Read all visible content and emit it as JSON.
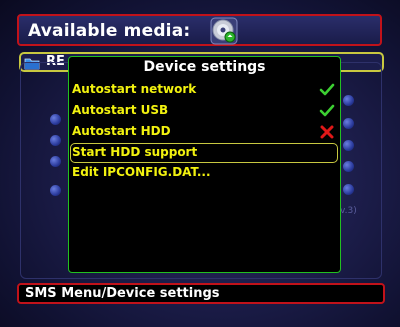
{
  "header": {
    "title": "Available media:",
    "media_icon": "disc-icon"
  },
  "file_row": {
    "icon": "folder-icon",
    "label": "RE"
  },
  "background": {
    "partial_text": "v.3)"
  },
  "dialog": {
    "title": "Device settings",
    "options": [
      {
        "label": "Autostart network",
        "state": "enabled",
        "icon": "check-icon"
      },
      {
        "label": "Autostart USB",
        "state": "enabled",
        "icon": "check-icon"
      },
      {
        "label": "Autostart HDD",
        "state": "disabled",
        "icon": "cross-icon"
      },
      {
        "label": "Start HDD support",
        "selected": true
      },
      {
        "label": "Edit IPCONFIG.DAT..."
      }
    ]
  },
  "statusbar": {
    "text": "SMS Menu/Device settings"
  },
  "colors": {
    "frame_red": "#c1121a",
    "dialog_border": "#22c020",
    "option_text": "#f2f20f",
    "selection_border": "#c8c840",
    "check": "#3ccf32",
    "cross": "#e01818"
  }
}
